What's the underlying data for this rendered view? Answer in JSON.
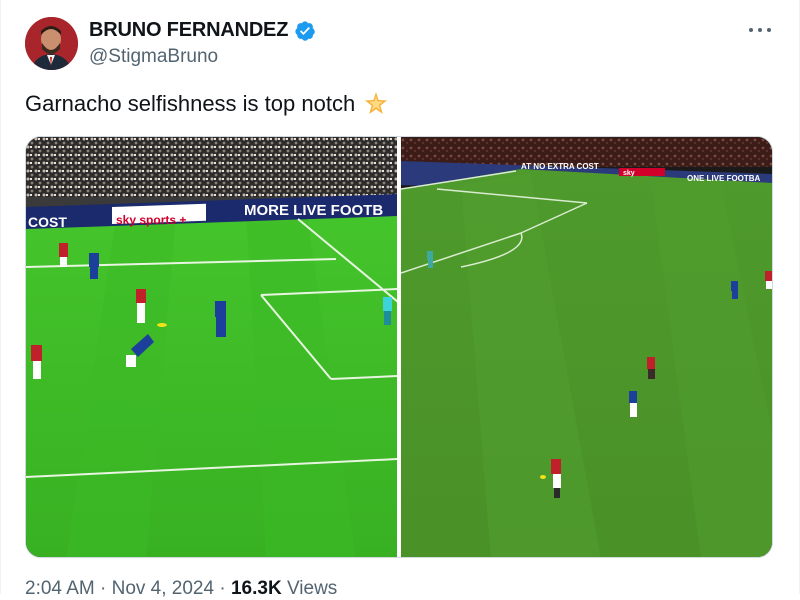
{
  "author": {
    "display_name": "BRUNO FERNANDEZ",
    "handle": "@StigmaBruno",
    "verified": true,
    "verified_color": "#1d9bf0"
  },
  "tweet": {
    "text": "Garnacho selfishness is top notch",
    "emoji": "glowing-star-emoji"
  },
  "media": {
    "left_photo": {
      "ad_boards": [
        "COST",
        "sky sports +",
        "MORE LIVE FOOTB"
      ]
    },
    "right_photo": {
      "ad_boards": [
        "AT NO EXTRA COST",
        "sky",
        "ONE LIVE FOOTBA"
      ]
    }
  },
  "footer": {
    "time": "2:04 AM",
    "sep1": "·",
    "date": "Nov 4, 2024",
    "sep2": "·",
    "views_count": "16.3K",
    "views_label": "Views"
  },
  "colors": {
    "text_primary": "#0f1419",
    "text_secondary": "#536471",
    "pitch_green": "#3fbf2a",
    "pitch_green_dark": "#4f9a2a"
  }
}
